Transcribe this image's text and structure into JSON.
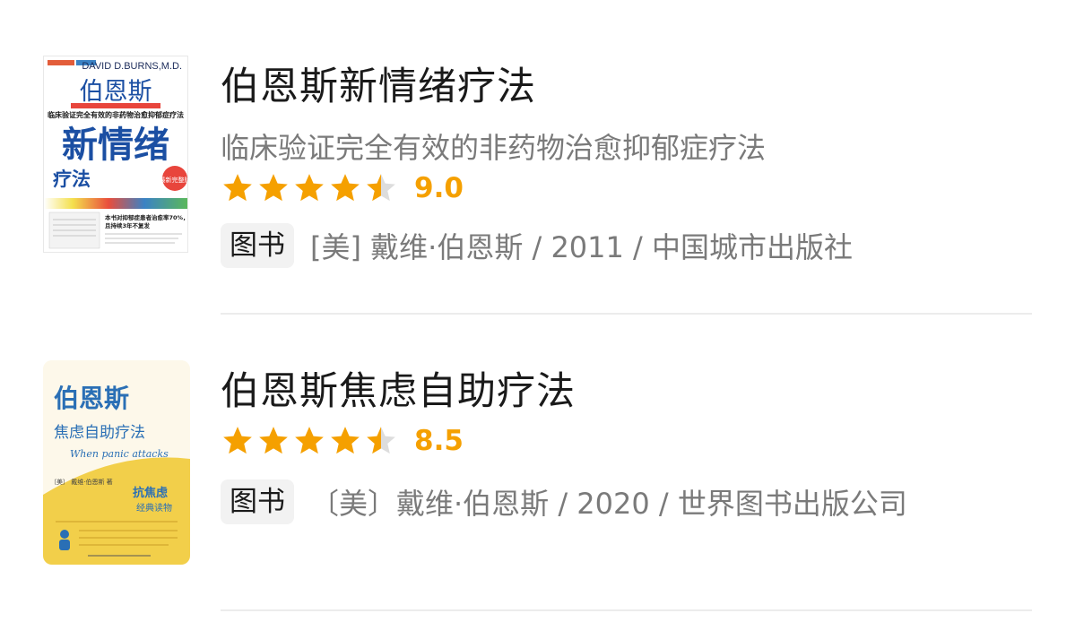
{
  "results": [
    {
      "title": "伯恩斯新情绪疗法",
      "subtitle": "临床验证完全有效的非药物治愈抑郁症疗法",
      "rating_stars": 4.5,
      "score": "9.0",
      "tag": "图书",
      "meta": "[美] 戴维·伯恩斯 / 2011 / 中国城市出版社",
      "cover": {
        "author_en": "DAVID D.BURNS,M.D.",
        "author_cn": "伯恩斯",
        "tagline": "临床验证完全有效的非药物治愈抑郁症疗法",
        "title_main": "新情绪",
        "title_sub": "疗法",
        "badge": "最新完整版",
        "blurb_1": "本书对抑郁症患者治愈率70%，",
        "blurb_2": "且持续3年不复发"
      }
    },
    {
      "title": "伯恩斯焦虑自助疗法",
      "subtitle": "",
      "rating_stars": 4.5,
      "score": "8.5",
      "tag": "图书",
      "meta": "〔美〕戴维·伯恩斯 / 2020 / 世界图书出版公司",
      "cover": {
        "author_cn": "伯恩斯",
        "title_main": "焦虑自助疗法",
        "title_en": "When panic attacks",
        "badge_1": "抗焦虑",
        "badge_2": "经典读物",
        "author_line": "〔美〕 戴维·伯恩斯 著"
      }
    }
  ],
  "colors": {
    "star": "#f5a000",
    "star_empty": "#dddddd",
    "score": "#f5a000",
    "cover1_blue": "#1b4fa3",
    "cover2_yellow": "#f2cf4a"
  }
}
